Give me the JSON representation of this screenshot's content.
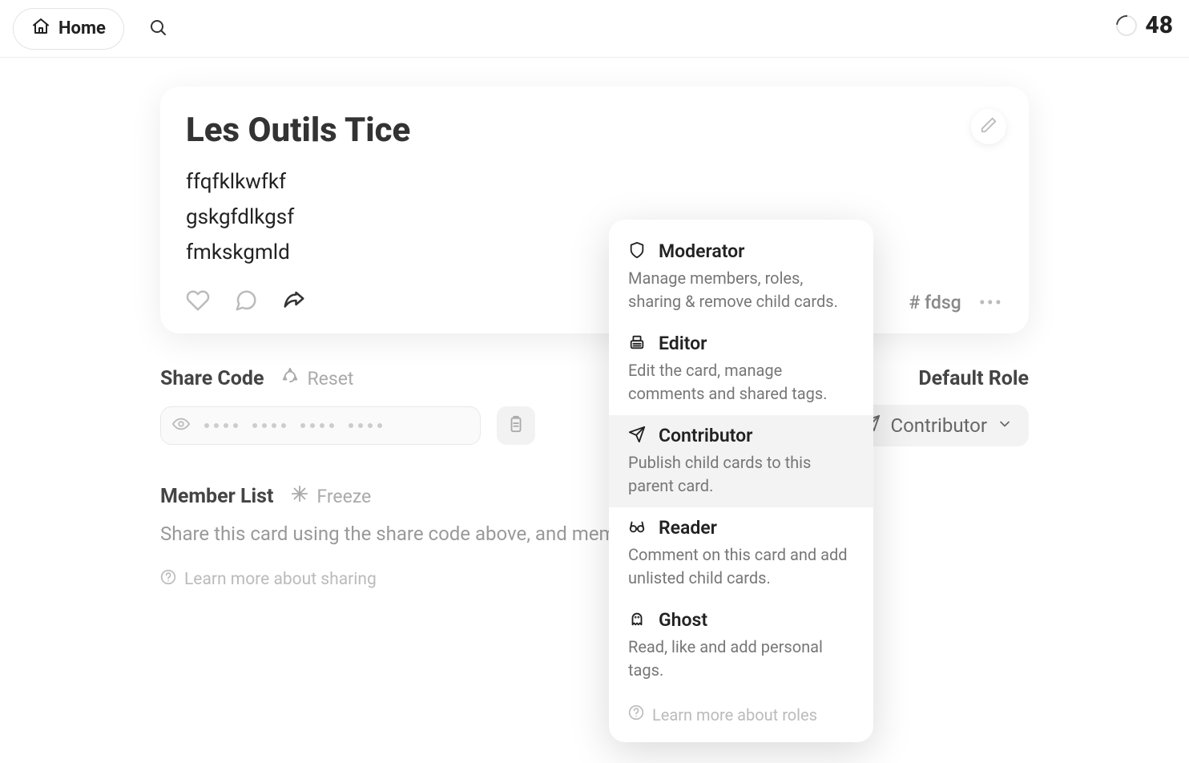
{
  "header": {
    "home_label": "Home",
    "count": "48"
  },
  "card": {
    "title": "Les Outils Tice",
    "lines": [
      "ffqfklkwfkf",
      "gskgfdlkgsf",
      "fmkskgmld"
    ],
    "tag": "# fdsg"
  },
  "share": {
    "title": "Share Code",
    "reset_label": "Reset",
    "default_role_title": "Default Role",
    "selected_role": "Contributor"
  },
  "member": {
    "title": "Member List",
    "freeze_label": "Freeze",
    "hint": "Share this card using the share code above, and members will appear here.",
    "learn_label": "Learn more about sharing"
  },
  "roles_popup": {
    "learn_label": "Learn more about roles",
    "items": [
      {
        "name": "Moderator",
        "desc": "Manage members, roles, sharing & remove child cards."
      },
      {
        "name": "Editor",
        "desc": "Edit the card, manage comments and shared tags."
      },
      {
        "name": "Contributor",
        "desc": "Publish child cards to this parent card."
      },
      {
        "name": "Reader",
        "desc": "Comment on this card and add unlisted child cards."
      },
      {
        "name": "Ghost",
        "desc": "Read, like and add personal tags."
      }
    ]
  }
}
